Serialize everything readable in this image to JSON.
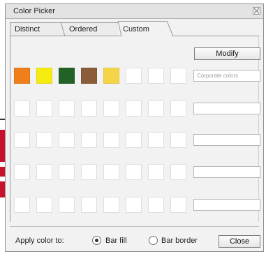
{
  "window": {
    "title": "Color Picker"
  },
  "tabs": [
    {
      "label": "Distinct",
      "active": false
    },
    {
      "label": "Ordered",
      "active": false
    },
    {
      "label": "Custom",
      "active": true
    }
  ],
  "toolbar": {
    "modify_label": "Modify"
  },
  "palette_rows": [
    {
      "swatches": [
        "#ef7f1a",
        "#f5ec12",
        "#236226",
        "#8a5c3a",
        "#f5d548",
        "#ffffff",
        "#ffffff",
        "#ffffff"
      ],
      "name_value": "",
      "name_placeholder": "Corporate colors"
    },
    {
      "swatches": [
        "#ffffff",
        "#ffffff",
        "#ffffff",
        "#ffffff",
        "#ffffff",
        "#ffffff",
        "#ffffff",
        "#ffffff"
      ],
      "name_value": "",
      "name_placeholder": ""
    },
    {
      "swatches": [
        "#ffffff",
        "#ffffff",
        "#ffffff",
        "#ffffff",
        "#ffffff",
        "#ffffff",
        "#ffffff",
        "#ffffff"
      ],
      "name_value": "",
      "name_placeholder": ""
    },
    {
      "swatches": [
        "#ffffff",
        "#ffffff",
        "#ffffff",
        "#ffffff",
        "#ffffff",
        "#ffffff",
        "#ffffff",
        "#ffffff"
      ],
      "name_value": "",
      "name_placeholder": ""
    },
    {
      "swatches": [
        "#ffffff",
        "#ffffff",
        "#ffffff",
        "#ffffff",
        "#ffffff",
        "#ffffff",
        "#ffffff",
        "#ffffff"
      ],
      "name_value": "",
      "name_placeholder": ""
    }
  ],
  "footer": {
    "apply_label": "Apply color to:",
    "options": [
      {
        "label": "Bar fill",
        "selected": true
      },
      {
        "label": "Bar border",
        "selected": false
      }
    ],
    "close_label": "Close"
  },
  "colors": {
    "background_accent": "#c8102e"
  },
  "icons": {
    "close": "close-icon"
  }
}
